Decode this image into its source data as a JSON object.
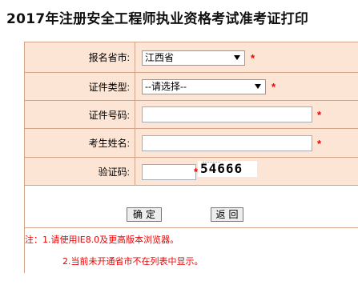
{
  "page_title": "2017年注册安全工程师执业资格考试准考证打印",
  "form": {
    "province": {
      "label": "报名省市:",
      "value": "江西省"
    },
    "id_type": {
      "label": "证件类型:",
      "value": "--请选择--"
    },
    "id_number": {
      "label": "证件号码:",
      "value": ""
    },
    "name": {
      "label": "考生姓名:",
      "value": ""
    },
    "captcha": {
      "label": "验证码:",
      "value": "",
      "image_text": "54666"
    },
    "required_mark": "*"
  },
  "buttons": {
    "confirm": "确定",
    "back": "返回"
  },
  "notes": {
    "line1": "注：1.请使用IE8.0及更高版本浏览器。",
    "line2": "2.当前未开通省市不在列表中显示。"
  },
  "colors": {
    "label_bg": "#fce5d4",
    "border": "#d2a58a",
    "required": "#ee0000"
  }
}
